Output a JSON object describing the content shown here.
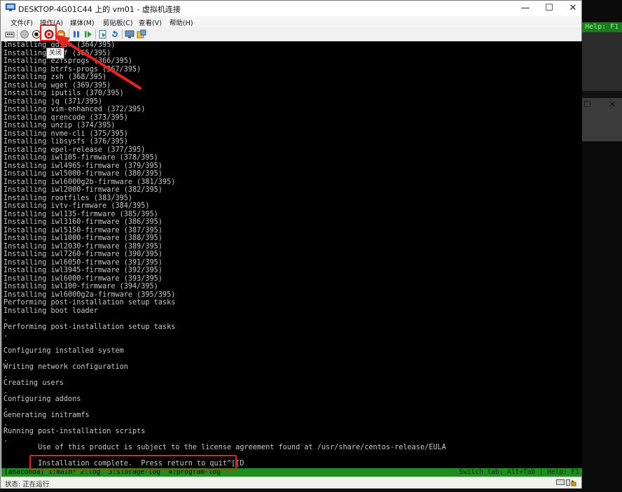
{
  "window": {
    "title": "DESKTOP-4G01C44 上的 vm01 - 虚拟机连接",
    "controls": {
      "minimize": "—",
      "maximize": "☐",
      "close": "✕"
    }
  },
  "menu": [
    "文件(F)",
    "操作(A)",
    "媒体(M)",
    "剪贴板(C)",
    "查看(V)",
    "帮助(H)"
  ],
  "toolbar": {
    "buttons": [
      "ctrl-alt-del",
      "start",
      "turn-off",
      "shut-down",
      "save",
      "pause",
      "resume",
      "checkpoint",
      "revert",
      "enhanced-session",
      "share"
    ],
    "tooltip": "关闭"
  },
  "console": {
    "lines": [
      "Installing gdisk (364/395)",
      "Installing lsof (365/395)",
      "Installing e2fsprogs (366/395)",
      "Installing btrfs-progs (367/395)",
      "Installing zsh (368/395)",
      "Installing wget (369/395)",
      "Installing iputils (370/395)",
      "Installing jq (371/395)",
      "Installing vim-enhanced (372/395)",
      "Installing qrencode (373/395)",
      "Installing unzip (374/395)",
      "Installing nvme-cli (375/395)",
      "Installing libsysfs (376/395)",
      "Installing epel-release (377/395)",
      "Installing iwl105-firmware (378/395)",
      "Installing iwl4965-firmware (379/395)",
      "Installing iwl5000-firmware (380/395)",
      "Installing iwl6000g2b-firmware (381/395)",
      "Installing iwl2000-firmware (382/395)",
      "Installing rootfiles (383/395)",
      "Installing ivtv-firmware (384/395)",
      "Installing iwl135-firmware (385/395)",
      "Installing iwl3160-firmware (386/395)",
      "Installing iwl5150-firmware (387/395)",
      "Installing iwl1000-firmware (388/395)",
      "Installing iwl2030-firmware (389/395)",
      "Installing iwl7260-firmware (390/395)",
      "Installing iwl6050-firmware (391/395)",
      "Installing iwl3945-firmware (392/395)",
      "Installing iwl6000-firmware (393/395)",
      "Installing iwl100-firmware (394/395)",
      "Installing iwl6000g2a-firmware (395/395)",
      "Performing post-installation setup tasks",
      "Installing boot loader",
      ".",
      "Performing post-installation setup tasks",
      ".",
      "",
      "Configuring installed system",
      ".",
      "Writing network configuration",
      ".",
      "Creating users",
      ".",
      "Configuring addons",
      ".",
      "Generating initramfs",
      ".",
      "Running post-installation scripts",
      ".",
      "        Use of this product is subject to the license agreement found at /usr/share/centos-release/EULA",
      "",
      "        Installation complete.  Press return to quit^[[D"
    ]
  },
  "tmux": {
    "left": "[anaconda] 1:main* 2:log  3:storage-log  4:program-log",
    "right": "Switch tab: Alt+Tab | Help: F1"
  },
  "status": {
    "label": "状态: 正在运行"
  },
  "background_window": {
    "strip_text": "Help: F1"
  },
  "colors": {
    "annotation": "#e8231e",
    "tmux_green": "#1e8f1e",
    "console_text": "#c8c8c8"
  }
}
